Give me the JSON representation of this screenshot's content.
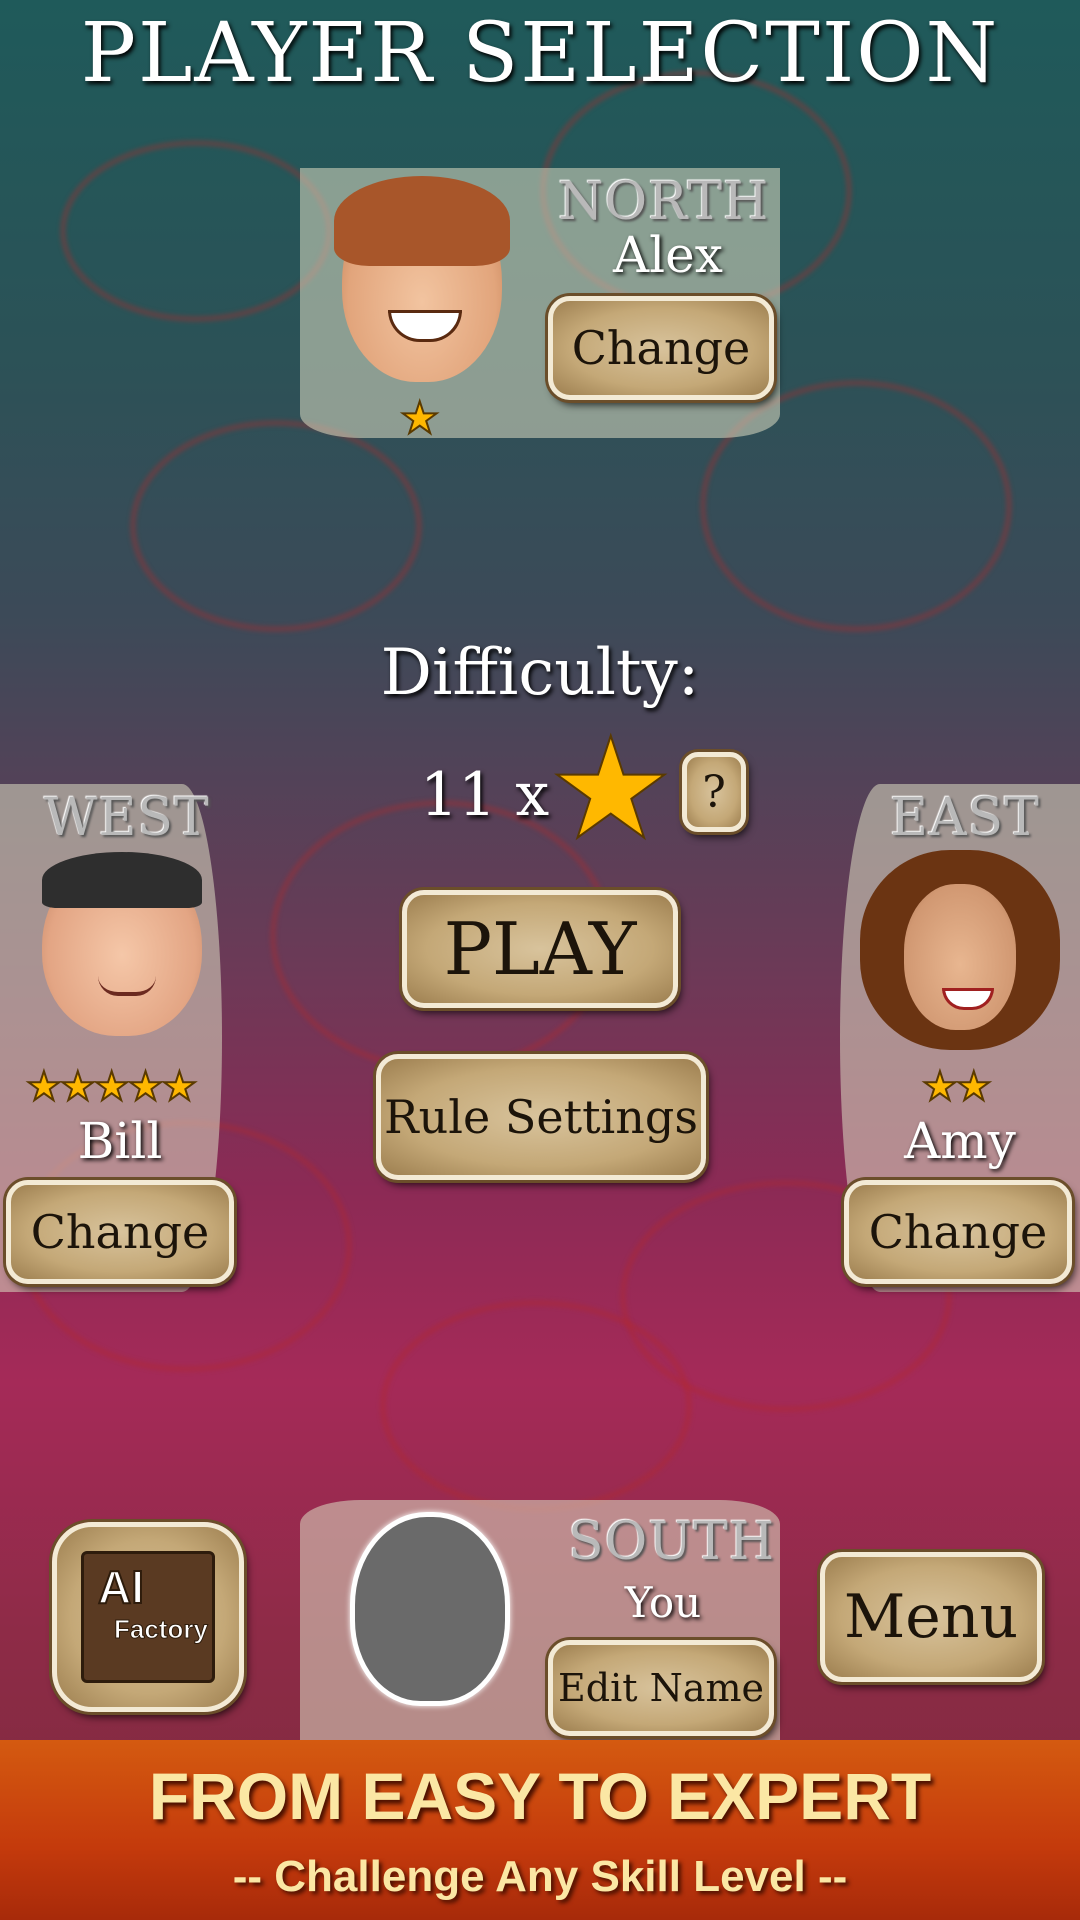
{
  "screen": {
    "title": "PLAYER SELECTION"
  },
  "north": {
    "direction": "NORTH",
    "name": "Alex",
    "change_label": "Change",
    "stars": 1
  },
  "west": {
    "direction": "WEST",
    "name": "Bill",
    "change_label": "Change",
    "stars": 5
  },
  "east": {
    "direction": "EAST",
    "name": "Amy",
    "change_label": "Change",
    "stars": 2
  },
  "south": {
    "direction": "SOUTH",
    "name": "You",
    "edit_label": "Edit Name"
  },
  "difficulty": {
    "label": "Difficulty:",
    "count": "11 x",
    "help_label": "?"
  },
  "buttons": {
    "play": "PLAY",
    "rules": "Rule Settings",
    "menu": "Menu"
  },
  "logo": {
    "line1": "AI",
    "line2": "Factory"
  },
  "banner": {
    "line1": "FROM EASY TO EXPERT",
    "line2": "-- Challenge Any Skill Level --"
  },
  "colors": {
    "star": "#ffb800",
    "button": "#c4a877",
    "banner": "#c43a0c"
  }
}
